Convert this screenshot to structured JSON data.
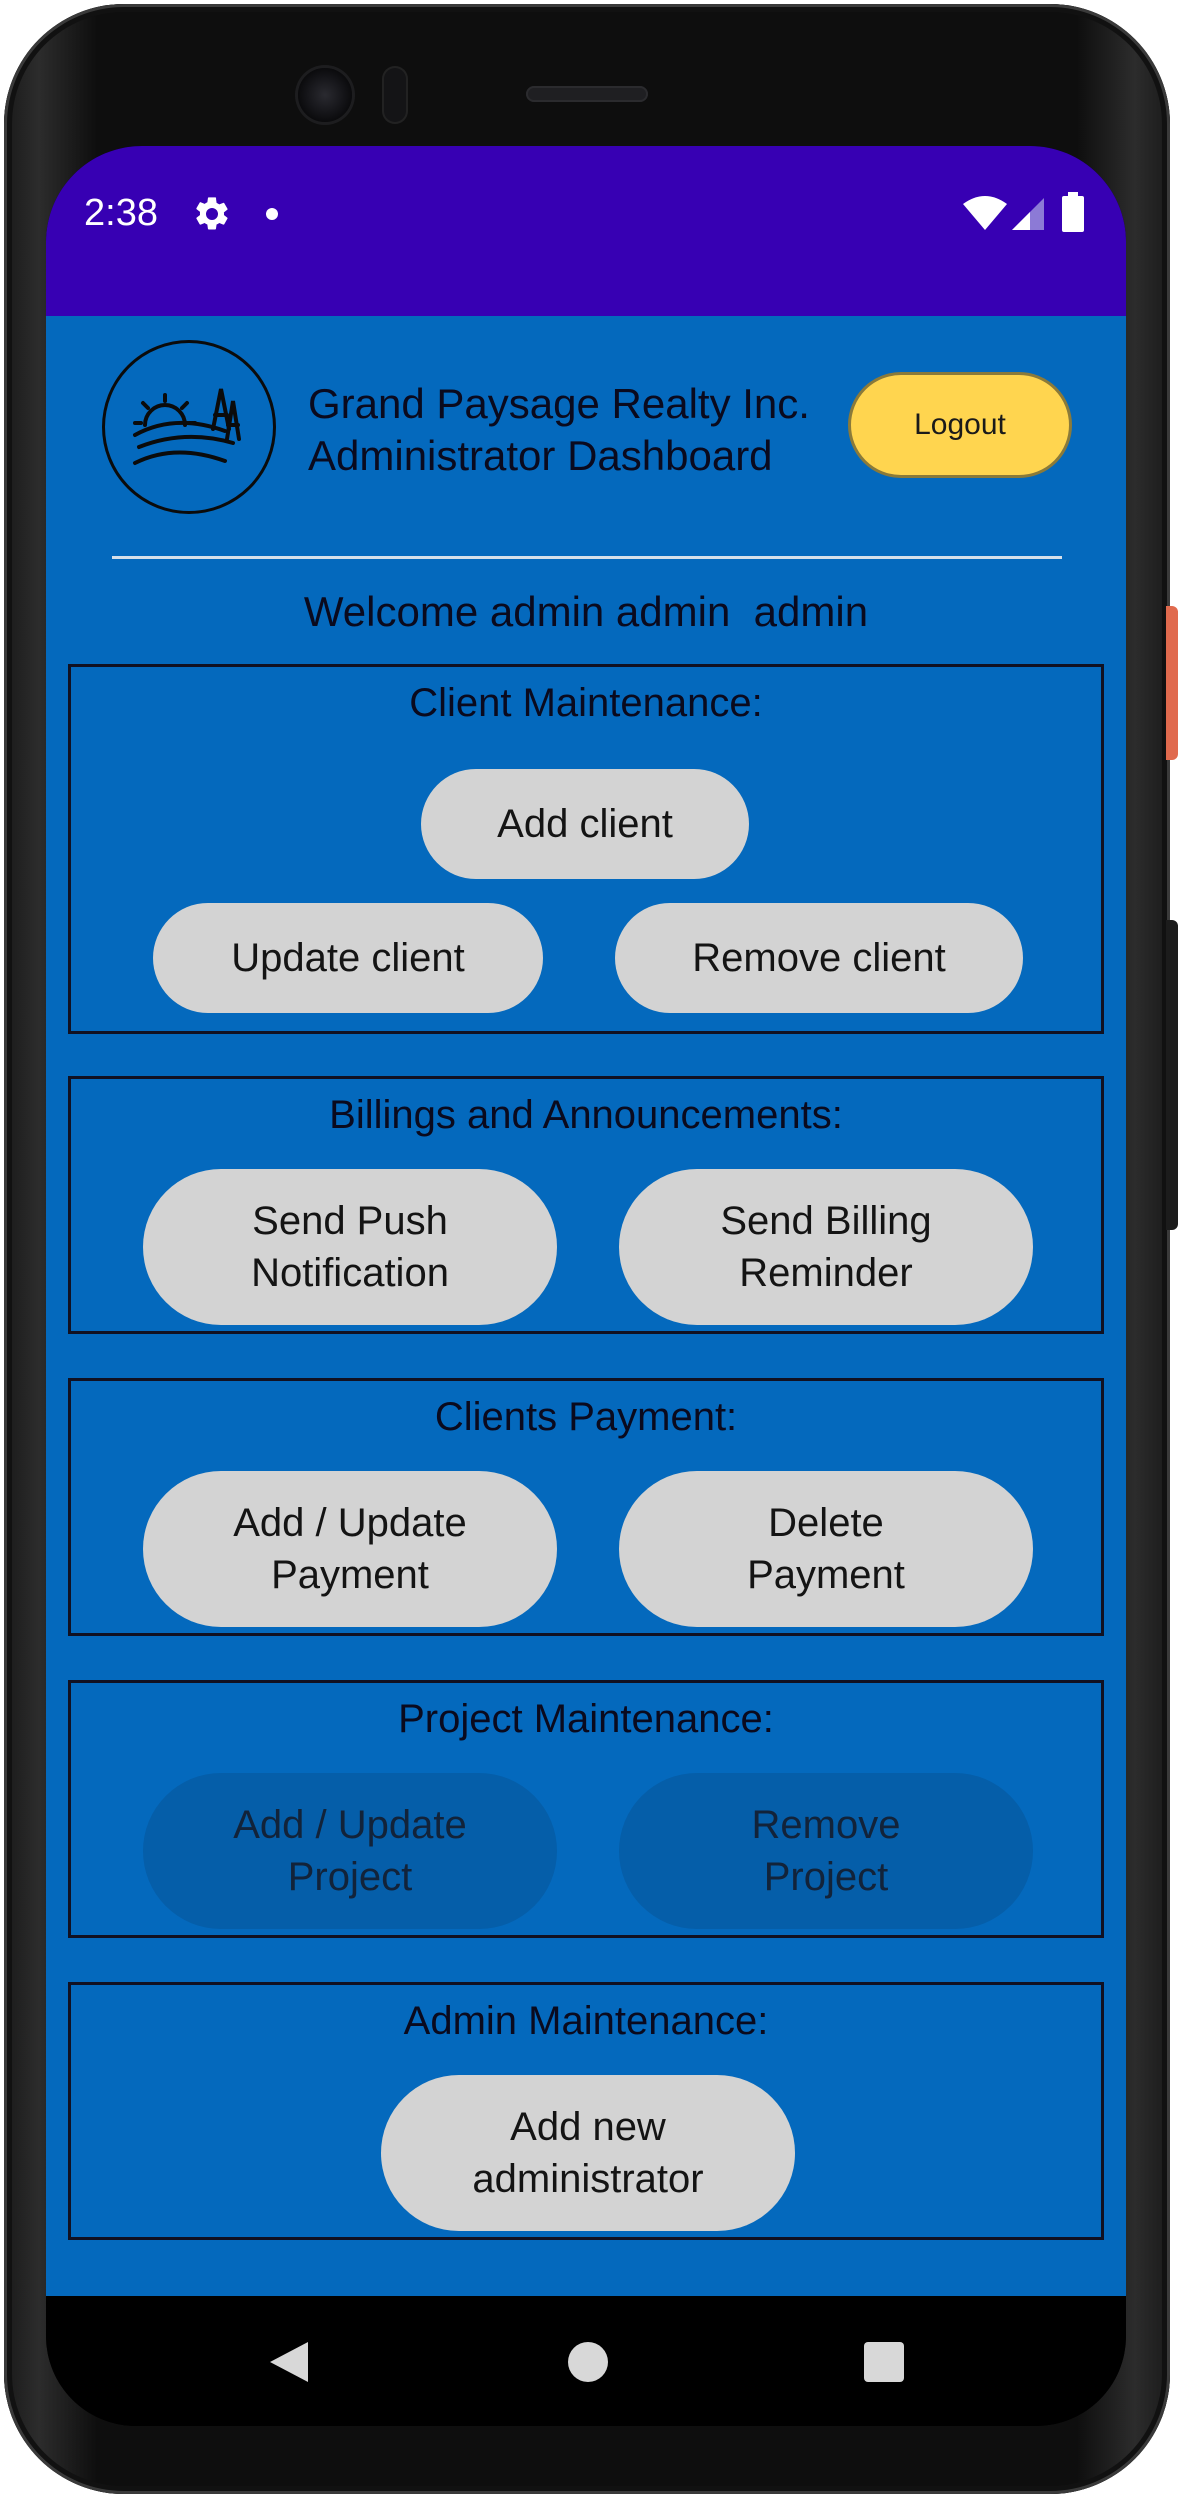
{
  "status_bar": {
    "time": "2:38",
    "icons": [
      "gear-icon",
      "notification-dot-icon",
      "wifi-icon",
      "signal-icon",
      "battery-icon"
    ],
    "background_color": "#3700b3"
  },
  "header": {
    "logo_icon": "landscape-sun-trees-icon",
    "company_line1": "Grand Paysage Realty Inc.",
    "company_line2": "Administrator Dashboard",
    "logout_label": "Logout",
    "logout_color": "#ffd54f"
  },
  "welcome_text": "Welcome admin admin  admin",
  "sections": {
    "client_maintenance": {
      "title": "Client Maintenance:",
      "add_label": "Add client",
      "update_label": "Update client",
      "remove_label": "Remove client"
    },
    "billings": {
      "title": "Billings and Announcements:",
      "push_line1": "Send Push",
      "push_line2": "Notification",
      "billing_line1": "Send Billing",
      "billing_line2": "Reminder"
    },
    "payments": {
      "title": "Clients Payment:",
      "add_line1": "Add / Update",
      "add_line2": "Payment",
      "delete_line1": "Delete",
      "delete_line2": "Payment"
    },
    "projects": {
      "title": "Project Maintenance:",
      "add_line1": "Add / Update",
      "add_line2": "Project",
      "remove_line1": "Remove",
      "remove_line2": "Project",
      "buttons_enabled": false
    },
    "admin": {
      "title": "Admin Maintenance:",
      "add_line1": "Add new",
      "add_line2": "administrator"
    }
  },
  "nav_bar": {
    "icons": [
      "back-icon",
      "home-icon",
      "recents-icon"
    ]
  },
  "colors": {
    "app_background": "#0469bd",
    "button_background": "#d3d3d3",
    "disabled_button_background": "#055ea9"
  }
}
